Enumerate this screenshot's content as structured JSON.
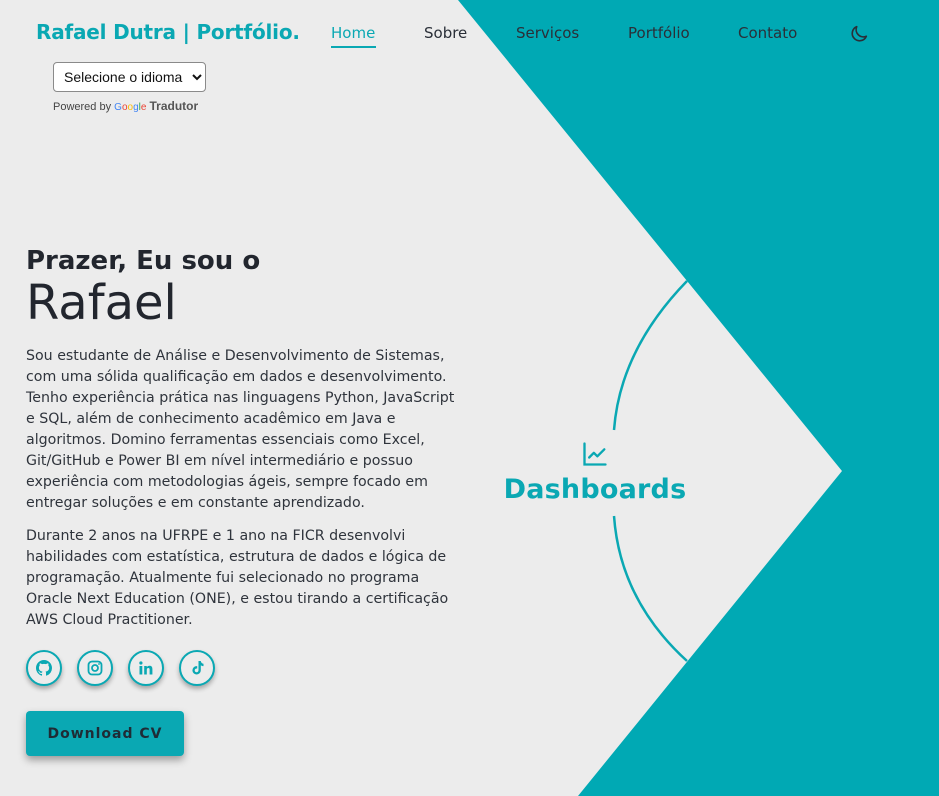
{
  "brand": {
    "logo_text": "Rafael Dutra | Portfólio."
  },
  "nav": {
    "items": [
      {
        "label": "Home",
        "active": true
      },
      {
        "label": "Sobre"
      },
      {
        "label": "Serviços"
      },
      {
        "label": "Portfólio"
      },
      {
        "label": "Contato"
      }
    ],
    "theme_icon": "moon-icon"
  },
  "translate": {
    "select_value": "Selecione o idioma",
    "powered_by": "Powered by",
    "google_logo": "Google",
    "tradutor": "Tradutor"
  },
  "hero": {
    "greeting": "Prazer, Eu sou o",
    "name": "Rafael",
    "bio_1": "Sou estudante de Análise e Desenvolvimento de Sistemas, com uma sólida qualificação em dados e desenvolvimento. Tenho experiência prática nas linguagens Python, JavaScript e SQL, além de conhecimento acadêmico em Java e algoritmos. Domino ferramentas essenciais como Excel, Git/GitHub e Power BI em nível intermediário e possuo experiência com metodologias ágeis, sempre focado em entregar soluções e em constante aprendizado.",
    "bio_2": "Durante 2 anos na UFRPE e 1 ano na FICR desenvolvi habilidades com estatística, estrutura de dados e lógica de programação. Atualmente fui selecionado no programa Oracle Next Education (ONE), e estou tirando a certificação AWS Cloud Practitioner."
  },
  "socials": [
    "github-icon",
    "instagram-icon",
    "linkedin-icon",
    "tiktok-icon"
  ],
  "cta": {
    "download_label": "Download CV"
  },
  "feature": {
    "icon": "chart-line-icon",
    "label": "Dashboards"
  },
  "colors": {
    "accent": "#0aa8b3",
    "background": "#ececec",
    "text": "#22262e"
  }
}
